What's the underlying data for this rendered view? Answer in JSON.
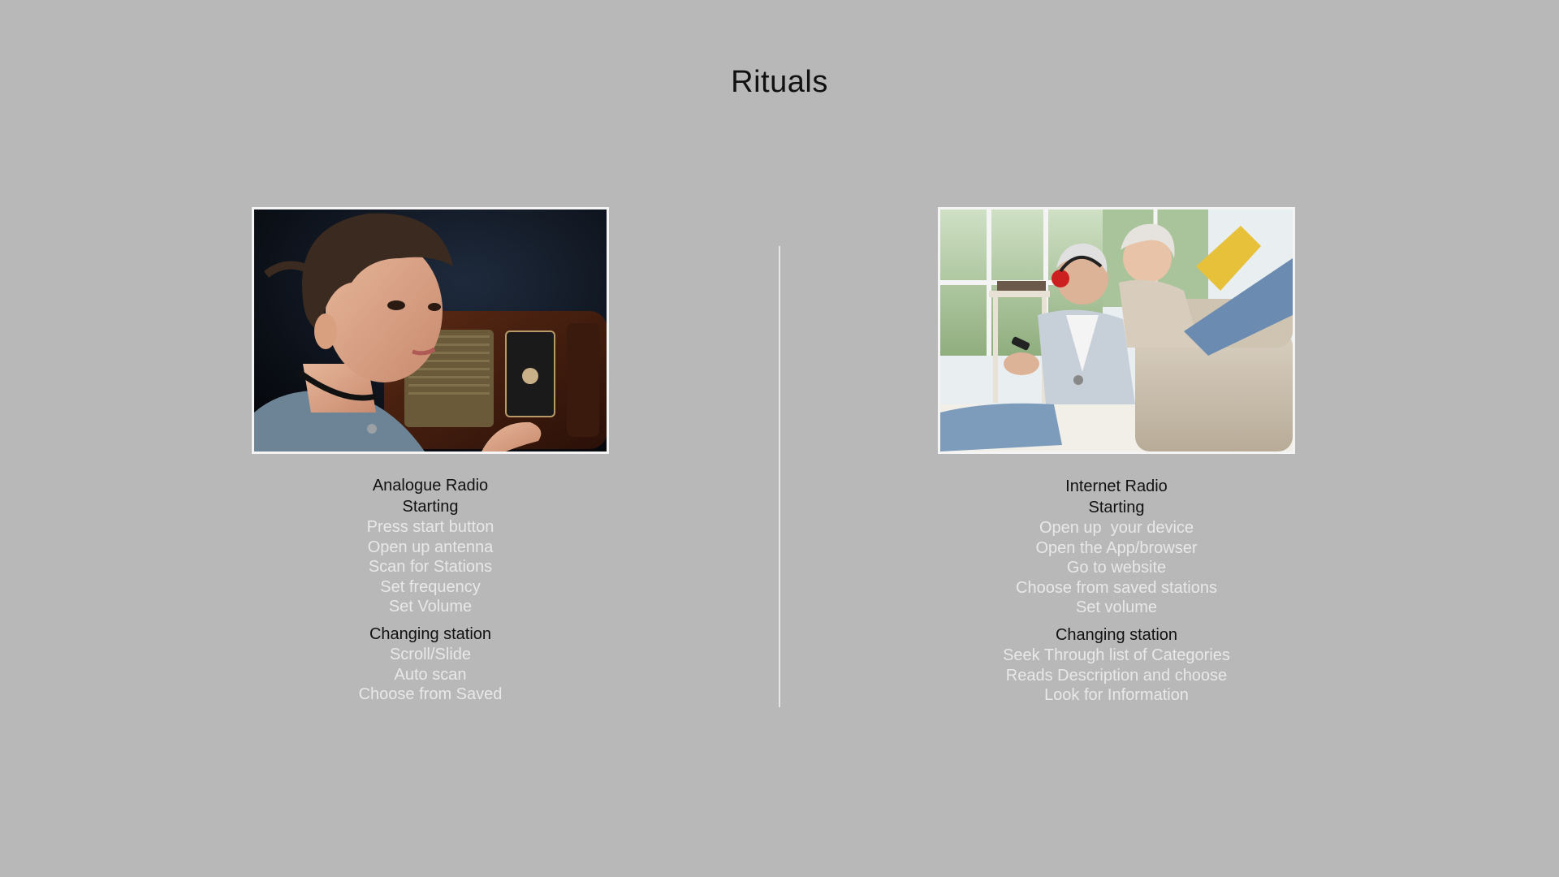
{
  "title": "Rituals",
  "left": {
    "heading": "Analogue Radio",
    "starting_label": "Starting",
    "starting_items": [
      "Press start button",
      "Open up antenna",
      "Scan for Stations",
      "Set frequency",
      "Set Volume"
    ],
    "changing_label": "Changing station",
    "changing_items": [
      "Scroll/Slide",
      "Auto scan",
      "Choose from Saved"
    ]
  },
  "right": {
    "heading": "Internet Radio",
    "starting_label": "Starting",
    "starting_items": [
      "Open up  your device",
      "Open the App/browser",
      "Go to website",
      "Choose from saved stations",
      "Set volume"
    ],
    "changing_label": "Changing station",
    "changing_items": [
      "Seek Through list of Categories",
      "Reads Description and choose",
      "Look for Information"
    ]
  }
}
